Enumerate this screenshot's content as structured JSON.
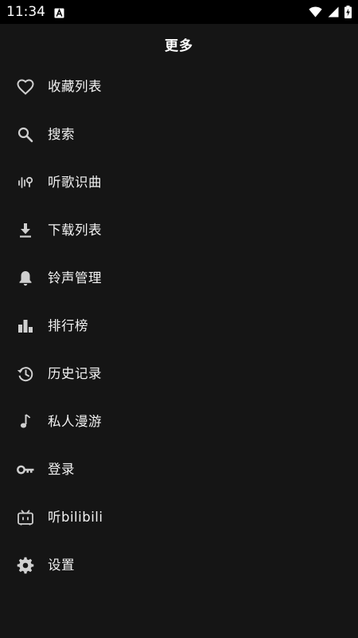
{
  "status_bar": {
    "time": "11:34",
    "notification_icon": "a-box-icon",
    "icons": [
      "wifi-icon",
      "signal-icon",
      "battery-charging-icon"
    ]
  },
  "header": {
    "title": "更多"
  },
  "menu": {
    "items": [
      {
        "label": "收藏列表",
        "icon": "heart-outline-icon"
      },
      {
        "label": "搜索",
        "icon": "search-icon"
      },
      {
        "label": "听歌识曲",
        "icon": "audio-recognize-icon"
      },
      {
        "label": "下载列表",
        "icon": "download-icon"
      },
      {
        "label": "铃声管理",
        "icon": "bell-icon"
      },
      {
        "label": "排行榜",
        "icon": "bar-chart-icon"
      },
      {
        "label": "历史记录",
        "icon": "history-icon"
      },
      {
        "label": "私人漫游",
        "icon": "music-note-icon"
      },
      {
        "label": "登录",
        "icon": "key-icon"
      },
      {
        "label": "听bilibili",
        "icon": "tv-icon"
      },
      {
        "label": "设置",
        "icon": "gear-icon"
      }
    ]
  },
  "colors": {
    "background": "#151515",
    "status_bar": "#000000",
    "text": "#f2f2f2",
    "icon": "#cfcfcf"
  }
}
